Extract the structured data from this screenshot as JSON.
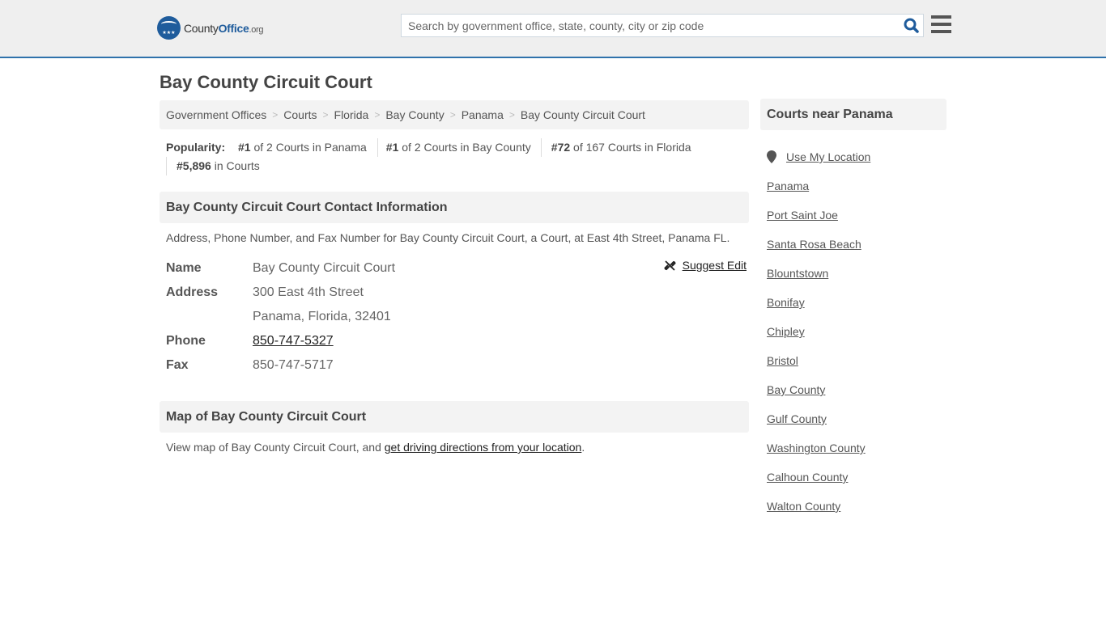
{
  "header": {
    "logo": {
      "part1": "County",
      "part2": "Office",
      "part3": ".org",
      "stars": "★★★"
    },
    "search": {
      "placeholder": "Search by government office, state, county, city or zip code",
      "value": ""
    },
    "colors": {
      "brand": "#1f5c9c",
      "border": "#2f72ab"
    }
  },
  "page": {
    "title": "Bay County Circuit Court",
    "breadcrumb": [
      {
        "label": "Government Offices"
      },
      {
        "label": "Courts"
      },
      {
        "label": "Florida"
      },
      {
        "label": "Bay County"
      },
      {
        "label": "Panama"
      },
      {
        "label": "Bay County Circuit Court"
      }
    ],
    "breadcrumb_sep": ">",
    "popularity": {
      "label": "Popularity:",
      "items": [
        {
          "rank": "#1",
          "text": "of 2 Courts in Panama"
        },
        {
          "rank": "#1",
          "text": "of 2 Courts in Bay County"
        },
        {
          "rank": "#72",
          "text": "of 167 Courts in Florida"
        },
        {
          "rank": "#5,896",
          "text": "in Courts"
        }
      ]
    }
  },
  "contact": {
    "heading": "Bay County Circuit Court Contact Information",
    "description": "Address, Phone Number, and Fax Number for Bay County Circuit Court, a Court, at East 4th Street, Panama FL.",
    "suggest_edit": "Suggest Edit",
    "fields": {
      "name_label": "Name",
      "name_value": "Bay County Circuit Court",
      "address_label": "Address",
      "address_line1": "300 East 4th Street",
      "address_line2": "Panama, Florida, 32401",
      "phone_label": "Phone",
      "phone_value": "850-747-5327",
      "fax_label": "Fax",
      "fax_value": "850-747-5717"
    }
  },
  "map": {
    "heading": "Map of Bay County Circuit Court",
    "text_before": "View map of Bay County Circuit Court, and ",
    "link": "get driving directions from your location",
    "text_after": "."
  },
  "sidebar": {
    "heading": "Courts near Panama",
    "use_location": "Use My Location",
    "links": [
      "Panama",
      "Port Saint Joe",
      "Santa Rosa Beach",
      "Blountstown",
      "Bonifay",
      "Chipley",
      "Bristol",
      "Bay County",
      "Gulf County",
      "Washington County",
      "Calhoun County",
      "Walton County"
    ]
  }
}
